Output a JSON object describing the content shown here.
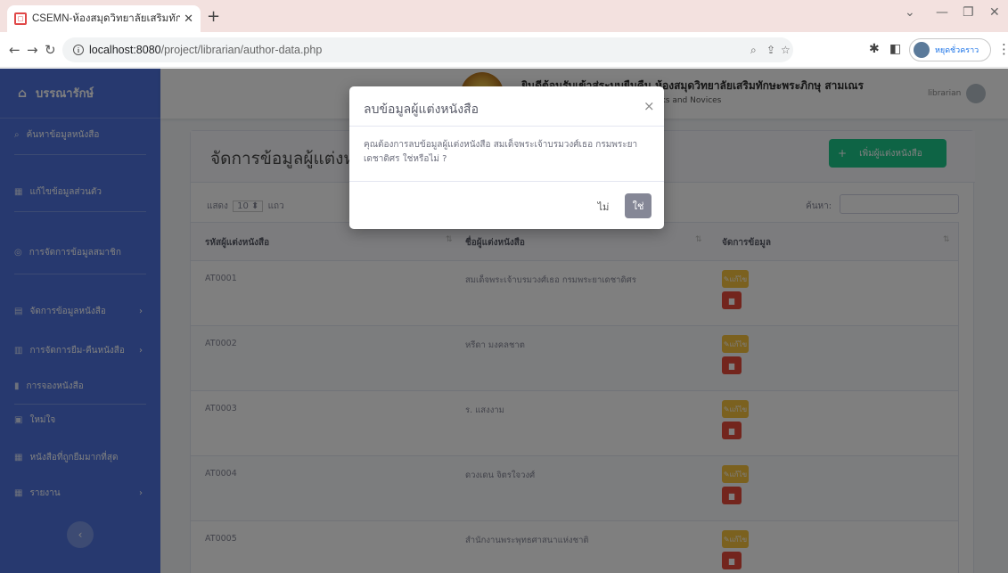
{
  "browser": {
    "tab_title": "CSEMN-ห้องสมุดวิทยาลัยเสริมทักษะ",
    "tab_icon": "favicon-icon",
    "url_host": "localhost:8080",
    "url_path": "/project/librarian/author-data.php",
    "profile_label": "หยุดชั่วคราว"
  },
  "sidebar": {
    "brand": "บรรณารักษ์",
    "items": [
      {
        "label": "ค้นหาข้อมูลหนังสือ",
        "icon": "search-icon"
      },
      {
        "label": "แก้ไขข้อมูลส่วนตัว",
        "icon": "user-icon"
      },
      {
        "label": "การจัดการข้อมูลสมาชิก",
        "icon": "users-icon"
      },
      {
        "label": "จัดการข้อมูลหนังสือ",
        "icon": "book-icon"
      },
      {
        "label": "การจัดการยืม-คืนหนังสือ",
        "icon": "exchange-icon"
      },
      {
        "label": "การจองหนังสือ",
        "icon": "bookmark-icon"
      },
      {
        "label": "ใหม่ใจ",
        "icon": "money-icon"
      },
      {
        "label": "หนังสือที่ถูกยืมมากที่สุด",
        "icon": "chart-icon"
      },
      {
        "label": "รายงาน",
        "icon": "report-icon"
      }
    ]
  },
  "header": {
    "title": "ยินดีต้อนรับเข้าสู่ระบบยืมคืน ห้องสมุดวิทยาลัยเสริมทักษะพระภิกษุ สามเณร",
    "subtitle": "ege of Skills Enhancement for Monks and Novices",
    "user": "librarian"
  },
  "card": {
    "title": "จัดการข้อมูลผู้แต่งหนังสือ",
    "add_button": "เพิ่มผู้แต่งหนังสือ"
  },
  "table_controls": {
    "show_prefix": "แสดง",
    "show_value": "10",
    "show_suffix": "แถว",
    "search_label": "ค้นหา:"
  },
  "table": {
    "headers": [
      "รหัสผู้แต่งหนังสือ",
      "ชื่อผู้แต่งหนังสือ",
      "จัดการข้อมูล"
    ],
    "edit_label": "แก้ไข",
    "delete_label": "ลบ",
    "rows": [
      {
        "id": "AT0001",
        "name": "สมเด็จพระเจ้าบรมวงศ์เธอ กรมพระยาเดชาดิศร"
      },
      {
        "id": "AT0002",
        "name": "หรีดา มงคลชาต"
      },
      {
        "id": "AT0003",
        "name": "ร. แสงงาม"
      },
      {
        "id": "AT0004",
        "name": "ดวงเดน จิตรใจวงศ์"
      },
      {
        "id": "AT0005",
        "name": "สำนักงานพระพุทธศาสนาแห่งชาติ"
      }
    ]
  },
  "modal": {
    "title": "ลบข้อมูลผู้แต่งหนังสือ",
    "message": "คุณต้องการลบข้อมูลผู้แต่งหนังสือ สมเด็จพระเจ้าบรมวงศ์เธอ กรมพระยาเดชาดิศร ใช่หรือไม่ ?",
    "no_label": "ไม่",
    "yes_label": "ใช่"
  }
}
